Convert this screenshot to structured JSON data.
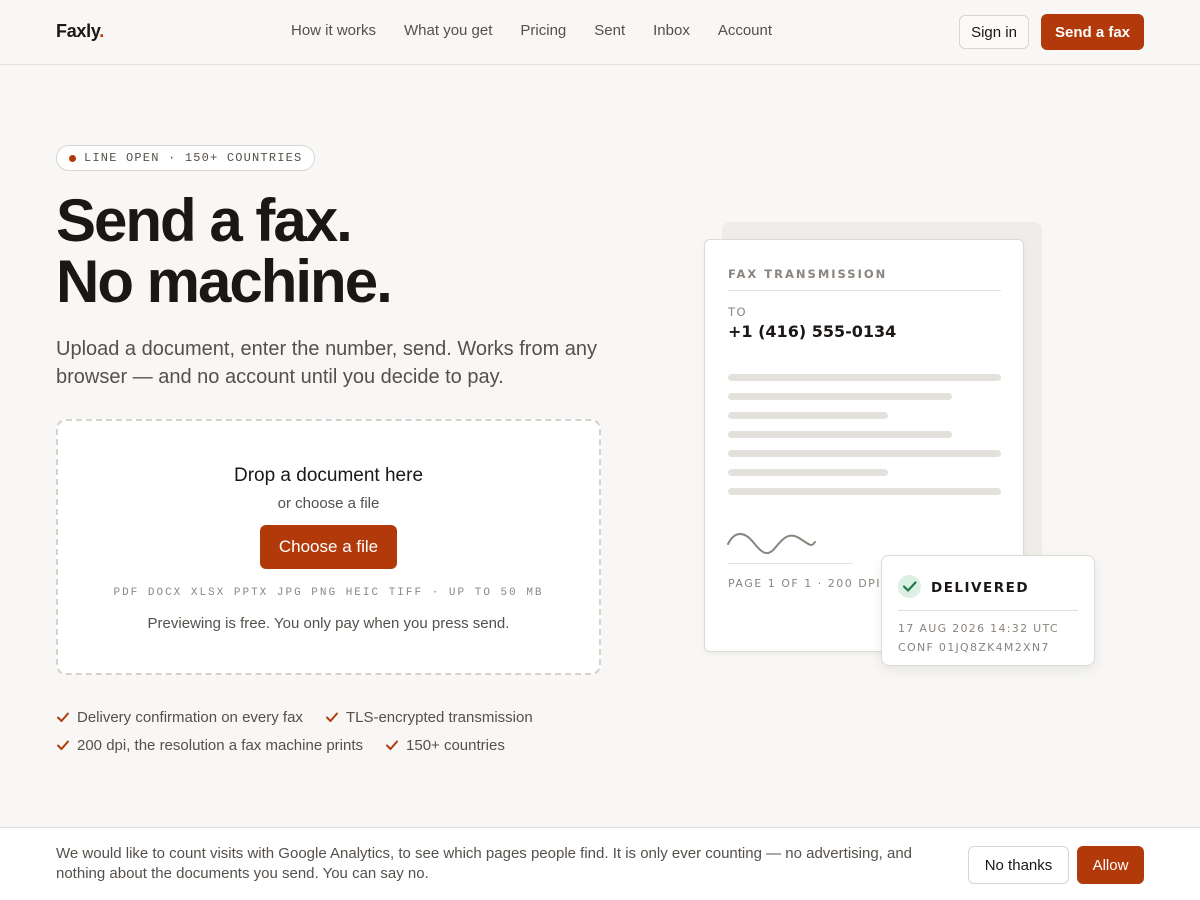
{
  "header": {
    "logo_text": "Faxly",
    "logo_dot": ".",
    "nav": [
      "How it works",
      "What you get",
      "Pricing",
      "Sent",
      "Inbox",
      "Account"
    ],
    "sign_in_label": "Sign in",
    "send_fax_label": "Send a fax"
  },
  "hero": {
    "status_pill": "LINE OPEN · 150+ COUNTRIES",
    "headline_line1": "Send a fax.",
    "headline_line2": "No machine.",
    "subhead": "Upload a document, enter the number, send. Works from any browser — and no account until you decide to pay.",
    "dropzone": {
      "title": "Drop a document here",
      "subtitle": "or choose a file",
      "button_label": "Choose a file",
      "formats": "PDF DOCX XLSX PPTX JPG PNG HEIC TIFF · UP TO 50 MB",
      "note": "Previewing is free. You only pay when you press send."
    },
    "features": [
      [
        "Delivery confirmation on every fax",
        "TLS-encrypted transmission"
      ],
      [
        "200 dpi, the resolution a fax machine prints",
        "150+ countries"
      ]
    ]
  },
  "preview": {
    "label": "FAX TRANSMISSION",
    "to_label": "TO",
    "number": "+1 (416) 555-0134",
    "page_info": "PAGE 1 OF 1 · 200 DPI",
    "delivered": {
      "title": "DELIVERED",
      "timestamp": "17 AUG 2026 14:32 UTC",
      "confirmation": "CONF 01JQ8ZK4M2XN7"
    }
  },
  "cookie": {
    "text": "We would like to count visits with Google Analytics, to see which pages people find. It is only ever counting — no advertising, and nothing about the documents you send. You can say no.",
    "decline_label": "No thanks",
    "accept_label": "Allow"
  },
  "colors": {
    "accent": "#b23a0a",
    "background": "#f8f7f5",
    "success_bg": "#dcefe3",
    "success": "#1f7a45"
  }
}
